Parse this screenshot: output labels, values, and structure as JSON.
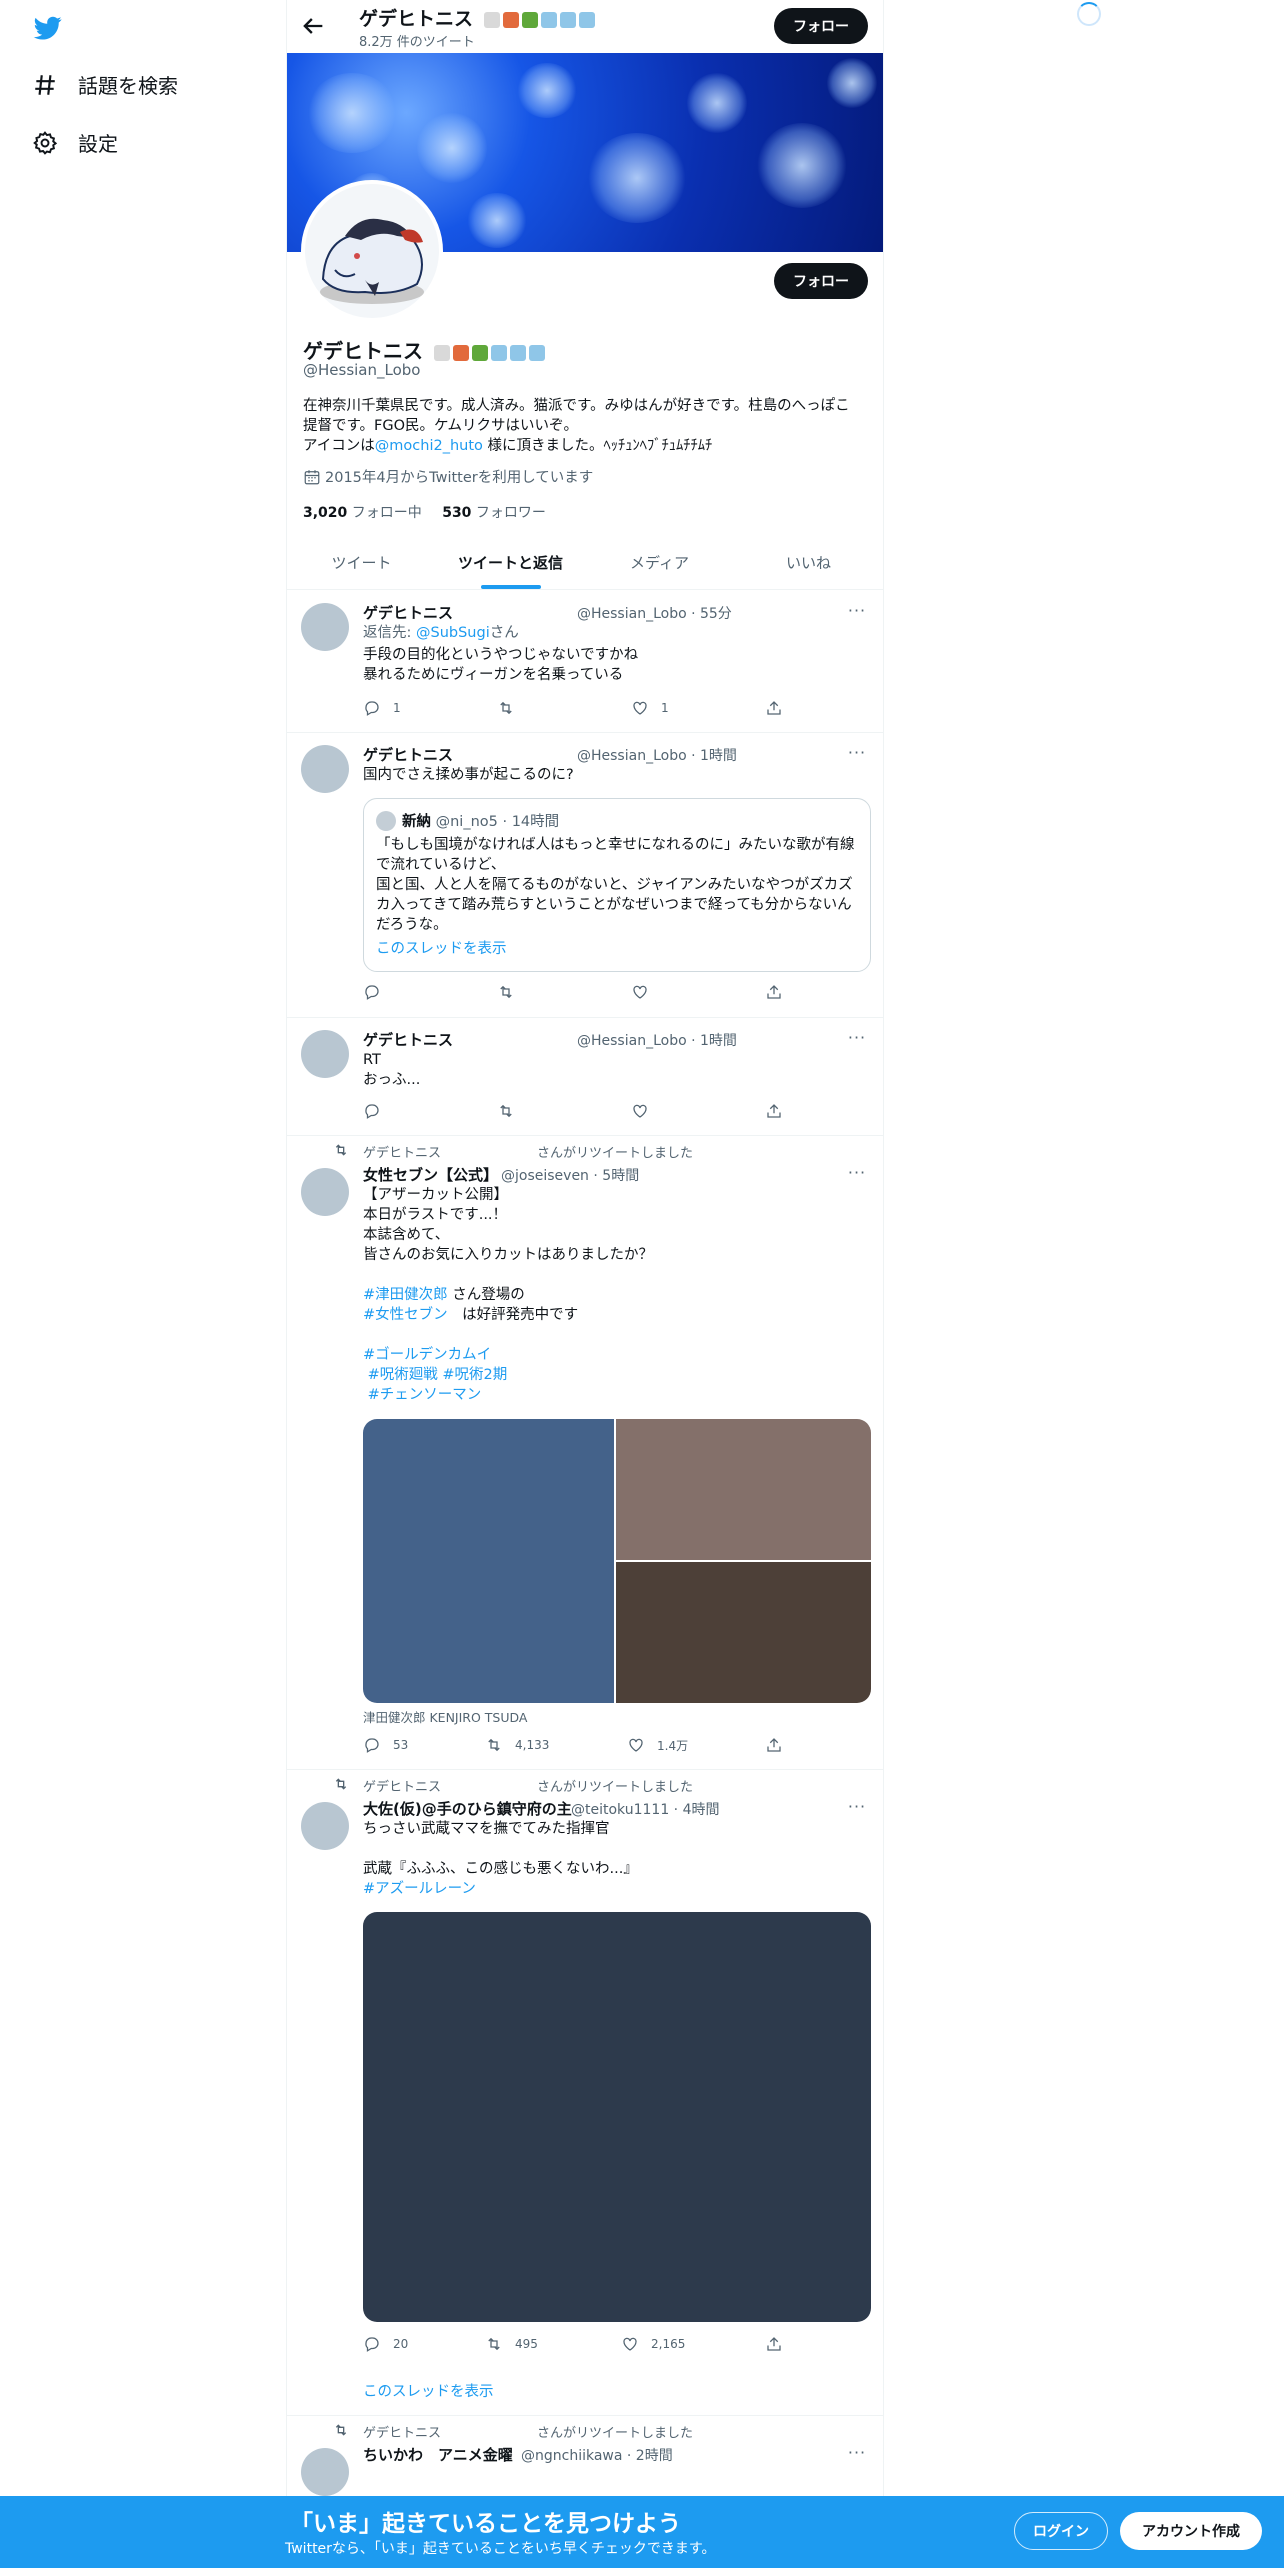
{
  "nav": {
    "explore_label": "話題を検索",
    "settings_label": "設定"
  },
  "profile": {
    "name": "ゲデヒトニス",
    "tweet_count": "8.2万 件のツイート",
    "follow_label": "フォロー",
    "handle": "@Hessian_Lobo",
    "bio_line1": "在神奈川千葉県民です。成人済み。猫派です。みゆはんが好きです。柱島のへっぽこ提督です。FGO民。ケムリクサはいいぞ。",
    "bio_line2_prefix": "アイコンは",
    "bio_mention": "@mochi2_huto",
    "bio_line2_suffix": " 様に頂きました。ﾍｯﾁｭﾝﾍﾌﾞﾁｭﾑﾁﾁﾑﾁ",
    "joined": "2015年4月からTwitterを利用しています",
    "following_count": "3,020",
    "following_label": " フォロー中",
    "followers_count": "530",
    "followers_label": " フォロワー",
    "emoji_colors": [
      "#d9d9d9",
      "#e26a3c",
      "#5fa83a",
      "#8fc6e8",
      "#8fc6e8",
      "#8fc6e8"
    ]
  },
  "tabs": [
    {
      "label": "ツイート"
    },
    {
      "label": "ツイートと返信"
    },
    {
      "label": "メディア"
    },
    {
      "label": "いいね"
    }
  ],
  "tweets": [
    {
      "name": "ゲデヒトニス",
      "meta": "@Hessian_Lobo · 55分",
      "reply_prefix": "返信先: ",
      "reply_to": "@SubSugi",
      "reply_suffix": "さん",
      "text": "手段の目的化というやつじゃないですかね\n暴れるためにヴィーガンを名乗っている",
      "replies": "1",
      "retweets": "",
      "likes": "1"
    },
    {
      "name": "ゲデヒトニス",
      "meta": "@Hessian_Lobo · 1時間",
      "text": "国内でさえ揉め事が起こるのに?",
      "quote": {
        "name": "新納",
        "meta": "@ni_no5 · 14時間",
        "text": "「もしも国境がなければ人はもっと幸せになれるのに」みたいな歌が有線で流れているけど、\n国と国、人と人を隔てるものがないと、ジャイアンみたいなやつがズカズカ入ってきて踏み荒らすということがなぜいつまで経っても分からないんだろうな。",
        "thread_link": "このスレッドを表示"
      }
    },
    {
      "name": "ゲデヒトニス",
      "meta": "@Hessian_Lobo · 1時間",
      "text": "RT\nおっふ..."
    },
    {
      "retweeted_by": "ゲデヒトニス",
      "retweeted_suffix": "さんがリツイートしました",
      "name": "女性セブン【公式】",
      "meta": "@joseiseven · 5時間",
      "text_a": "【アザーカット公開】\n本日がラストです...！\n本誌含めて、\n皆さんのお気に入りカットはありましたか？",
      "tag1": "#津田健次郎",
      "tag1_suffix": " さん登場の",
      "tag2": "#女性セブン",
      "tag2_suffix": "　は好評発売中です",
      "tag3": "#ゴールデンカムイ",
      "tag4": "#呪術廻戦",
      "tag5": "#呪術2期",
      "tag6": "#チェンソーマン",
      "media_caption": "津田健次郎 KENJIRO TSUDA",
      "media_colors": [
        "#44628a",
        "#84706a",
        "#4d4038"
      ],
      "replies": "53",
      "retweets": "4,133",
      "likes": "1.4万"
    },
    {
      "retweeted_by": "ゲデヒトニス",
      "retweeted_suffix": "さんがリツイートしました",
      "name": "大佐(仮)@手のひら鎮守府の主",
      "meta": "@teitoku1111 · 4時間",
      "text": "ちっさい武蔵ママを撫でてみた指揮官\n\n武蔵『ふふふ、この感じも悪くないわ...』",
      "tag": "#アズールレーン",
      "media_color": "#2d3a4c",
      "replies": "20",
      "retweets": "495",
      "likes": "2,165",
      "thread_link": "このスレッドを表示"
    },
    {
      "retweeted_by": "ゲデヒトニス",
      "retweeted_suffix": "さんがリツイートしました",
      "name": "ちいかわ　アニメ金曜",
      "meta": "@ngnchiikawa · 2時間"
    }
  ],
  "bottom": {
    "title": "「いま」起きていることを見つけよう",
    "subtitle": "Twitterなら、「いま」起きていることをいち早くチェックできます。",
    "login": "ログイン",
    "signup": "アカウント作成"
  }
}
